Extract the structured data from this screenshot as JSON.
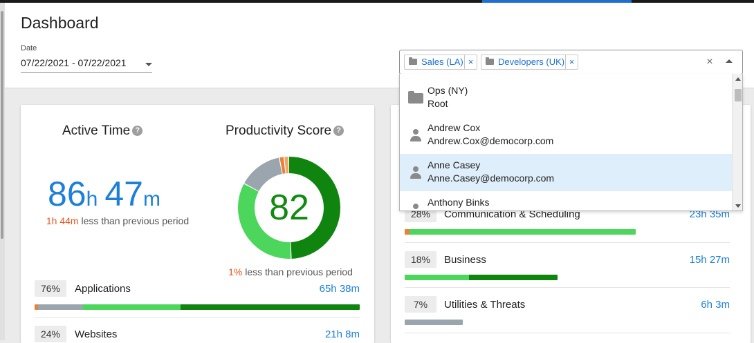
{
  "header": {
    "title": "Dashboard",
    "date_label": "Date",
    "date_value": "07/22/2021 - 07/22/2021"
  },
  "filter": {
    "chips": [
      {
        "label": "Sales (LA)",
        "icon": "folder-icon",
        "remove": "×"
      },
      {
        "label": "Developers (UK)",
        "icon": "folder-icon",
        "remove": "×"
      }
    ],
    "clear": "×",
    "options": [
      {
        "line1": "Ops (NY)",
        "line2": "Root",
        "icon": "folder-icon",
        "selected": false
      },
      {
        "line1": "Andrew Cox",
        "line2": "Andrew.Cox@democorp.com",
        "icon": "person-icon",
        "selected": false
      },
      {
        "line1": "Anne Casey",
        "line2": "Anne.Casey@democorp.com",
        "icon": "person-icon",
        "selected": true
      },
      {
        "line1": "Anthony Binks",
        "line2": "",
        "icon": "person-icon",
        "selected": false
      }
    ]
  },
  "active_time": {
    "title": "Active Time",
    "help": "?",
    "hours": "86",
    "hours_unit": "h",
    "minutes": "47",
    "minutes_unit": "m",
    "cmp_value": "1h 44m",
    "cmp_text": "less than previous period"
  },
  "productivity": {
    "title": "Productivity Score",
    "help": "?",
    "score": "82",
    "cmp_value": "1%",
    "cmp_text": "less than previous period",
    "donut_segments": [
      {
        "label": "productive",
        "fraction": 0.495,
        "color": "#0f840f"
      },
      {
        "label": "productive-passive",
        "fraction": 0.335,
        "color": "#4cd65c"
      },
      {
        "label": "unproductive-passive",
        "fraction": 0.14,
        "color": "#9aa5ad"
      },
      {
        "label": "unproductive",
        "fraction": 0.015,
        "color": "#e8823a"
      },
      {
        "label": "undefined",
        "fraction": 0.015,
        "color": "#f0a86a"
      }
    ]
  },
  "left_rows": [
    {
      "pct": "76%",
      "label": "Applications",
      "time": "65h 38m",
      "bar": [
        {
          "fraction": 0.01,
          "color": "#e8823a"
        },
        {
          "fraction": 0.14,
          "color": "#9aa5ad"
        },
        {
          "fraction": 0.3,
          "color": "#4cd65c"
        },
        {
          "fraction": 0.55,
          "color": "#0f840f"
        }
      ]
    },
    {
      "pct": "24%",
      "label": "Websites",
      "time": "21h 8m",
      "bar": []
    }
  ],
  "right_rows": [
    {
      "pct": "28%",
      "label": "Communication & Scheduling",
      "time": "23h 35m",
      "bar": [
        {
          "fraction": 0.02,
          "color": "#e8823a"
        },
        {
          "fraction": 0.98,
          "color": "#4cd65c"
        }
      ]
    },
    {
      "pct": "18%",
      "label": "Business",
      "time": "15h 27m",
      "bar": [
        {
          "fraction": 0.42,
          "color": "#4cd65c"
        },
        {
          "fraction": 0.58,
          "color": "#0f840f"
        }
      ]
    },
    {
      "pct": "7%",
      "label": "Utilities & Threats",
      "time": "6h 3m",
      "bar": [
        {
          "fraction": 1.0,
          "color": "#9aa5ad"
        }
      ]
    }
  ],
  "colors": {
    "accent": "#1e7fd8",
    "negative": "#e8541e",
    "score": "#128a12",
    "selected_row": "#dfeefb"
  }
}
